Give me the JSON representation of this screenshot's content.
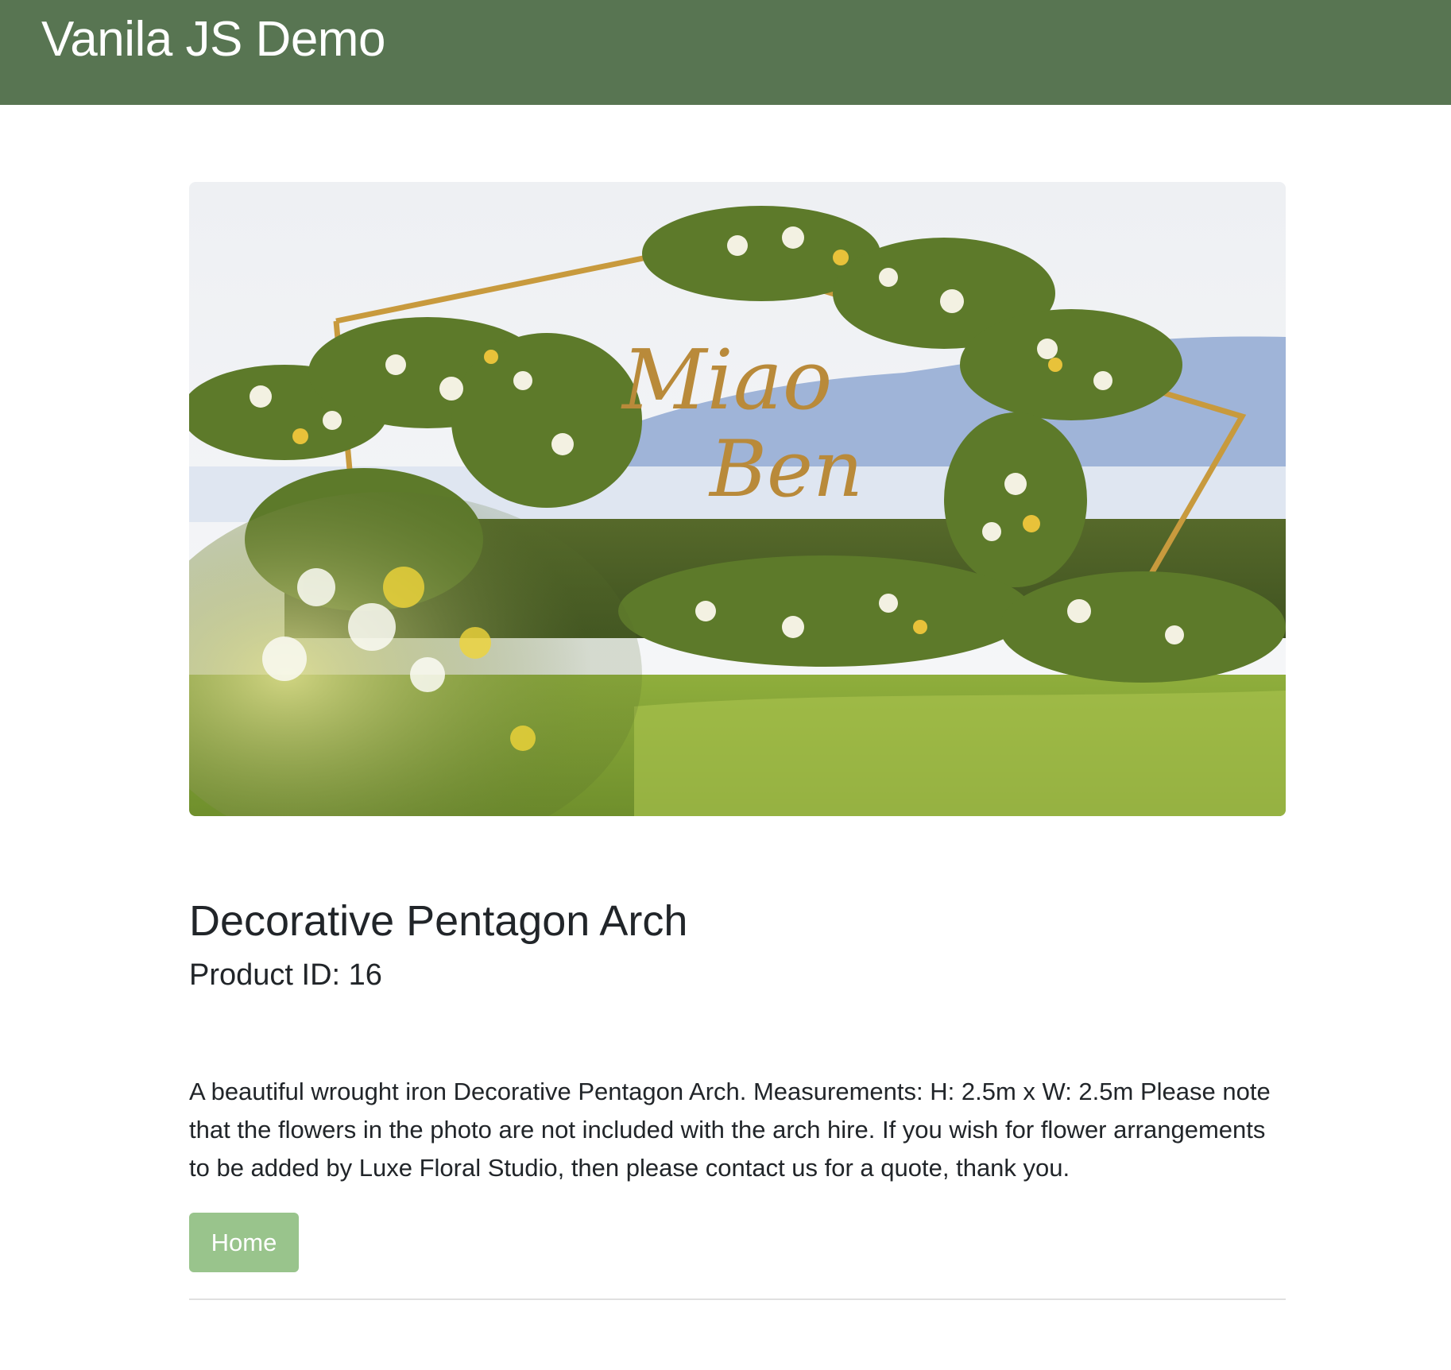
{
  "navbar": {
    "brand": "Vanila JS Demo",
    "background_color": "#587552"
  },
  "product": {
    "image_alt": "Decorative Pentagon Arch with flowers",
    "image_sign_line1": "Miao",
    "image_sign_line2": "Ben",
    "title": "Decorative Pentagon Arch",
    "id_text": "Product ID: 16",
    "description": "A beautiful wrought iron Decorative Pentagon Arch. Measurements: H: 2.5m x W: 2.5m Please note that the flowers in the photo are not included with the arch hire. If you wish for flower arrangements to be added by Luxe Floral Studio, then please contact us for a quote, thank you."
  },
  "actions": {
    "home_label": "Home",
    "home_color": "#99c48c"
  }
}
